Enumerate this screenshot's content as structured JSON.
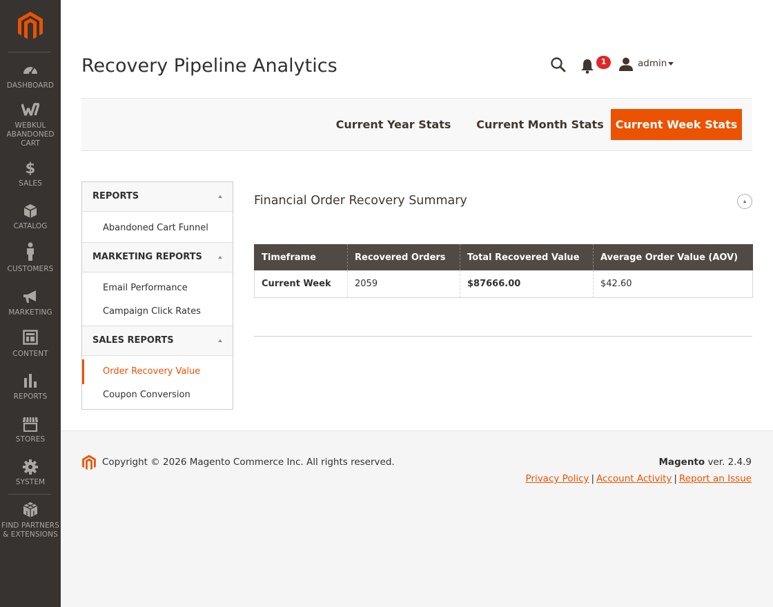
{
  "sidebar": {
    "items": [
      {
        "label": "DASHBOARD",
        "icon": "dashboard-icon"
      },
      {
        "label": "WEBKUL\nABANDONED\nCART",
        "icon": "webkul-icon"
      },
      {
        "label": "SALES",
        "icon": "dollar-icon"
      },
      {
        "label": "CATALOG",
        "icon": "cube-icon"
      },
      {
        "label": "CUSTOMERS",
        "icon": "person-icon"
      },
      {
        "label": "MARKETING",
        "icon": "megaphone-icon"
      },
      {
        "label": "CONTENT",
        "icon": "layout-icon"
      },
      {
        "label": "REPORTS",
        "icon": "bar-chart-icon"
      },
      {
        "label": "STORES",
        "icon": "store-icon"
      },
      {
        "label": "SYSTEM",
        "icon": "gear-icon"
      },
      {
        "label": "FIND PARTNERS\n& EXTENSIONS",
        "icon": "blocks-icon"
      }
    ]
  },
  "header": {
    "title": "Recovery Pipeline Analytics",
    "notification_count": "1",
    "user": "admin"
  },
  "stats_tabs": [
    {
      "label": "Current Year Stats"
    },
    {
      "label": "Current Month Stats"
    },
    {
      "label": "Current Week Stats",
      "active": true
    }
  ],
  "report_nav": {
    "groups": [
      {
        "title": "REPORTS",
        "links": [
          "Abandoned Cart Funnel"
        ]
      },
      {
        "title": "MARKETING REPORTS",
        "links": [
          "Email Performance",
          "Campaign Click Rates"
        ]
      },
      {
        "title": "SALES REPORTS",
        "links": [
          "Order Recovery Value",
          "Coupon Conversion"
        ]
      }
    ],
    "active_link": "Order Recovery Value"
  },
  "summary": {
    "title": "Financial Order Recovery Summary",
    "columns": [
      "Timeframe",
      "Recovered Orders",
      "Total Recovered Value",
      "Average Order Value (AOV)"
    ],
    "rows": [
      [
        "Current Week",
        "2059",
        "$87666.00",
        "$42.60"
      ]
    ]
  },
  "footer": {
    "copyright": "Copyright © 2026 Magento Commerce Inc. All rights reserved.",
    "brand": "Magento",
    "version": " ver. 2.4.9",
    "links": [
      "Privacy Policy",
      "Account Activity",
      "Report an Issue"
    ]
  },
  "colors": {
    "accent": "#eb5202",
    "sidebar_bg": "#373330",
    "table_header": "#514943",
    "badge": "#e22626"
  }
}
